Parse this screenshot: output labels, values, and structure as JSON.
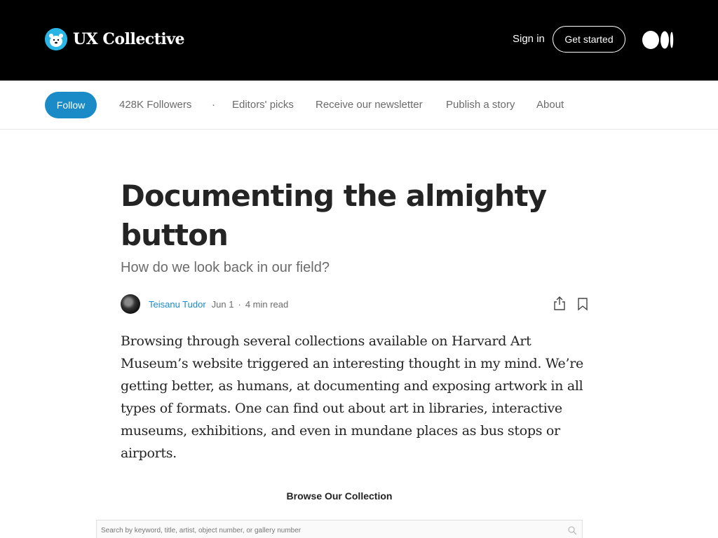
{
  "header": {
    "brand_name": "UX Collective",
    "signin_label": "Sign in",
    "getstarted_label": "Get started"
  },
  "subnav": {
    "follow_label": "Follow",
    "followers": "428K Followers",
    "dot": "·",
    "editors_picks": "Editors' picks",
    "newsletter": "Receive our newsletter",
    "publish": "Publish a story",
    "about": "About"
  },
  "article": {
    "title": "Documenting the almighty button",
    "subtitle": "How do we look back in our field?",
    "author": "Teisanu Tudor",
    "date": "Jun 1",
    "separator": "·",
    "read_time": "4 min read",
    "body": "Browsing through several collections available on Harvard Art Museum’s website triggered an interesting thought in my mind. We’re getting better, as humans, at documenting and exposing artwork in all types of formats. One can find out about art in libraries, interactive museums, exhibitions, and even in mundane places as bus stops or airports."
  },
  "figure": {
    "title": "Browse Our Collection",
    "search_placeholder": "Search by keyword, title, artist, object number, or gallery number"
  },
  "colors": {
    "header_bg": "#000000",
    "accent": "#1a8bc7",
    "text": "#242424",
    "muted": "#6b6b6b"
  },
  "icons": [
    "polar-bear-logo",
    "medium-logo",
    "share-icon",
    "bookmark-icon",
    "search-icon"
  ]
}
